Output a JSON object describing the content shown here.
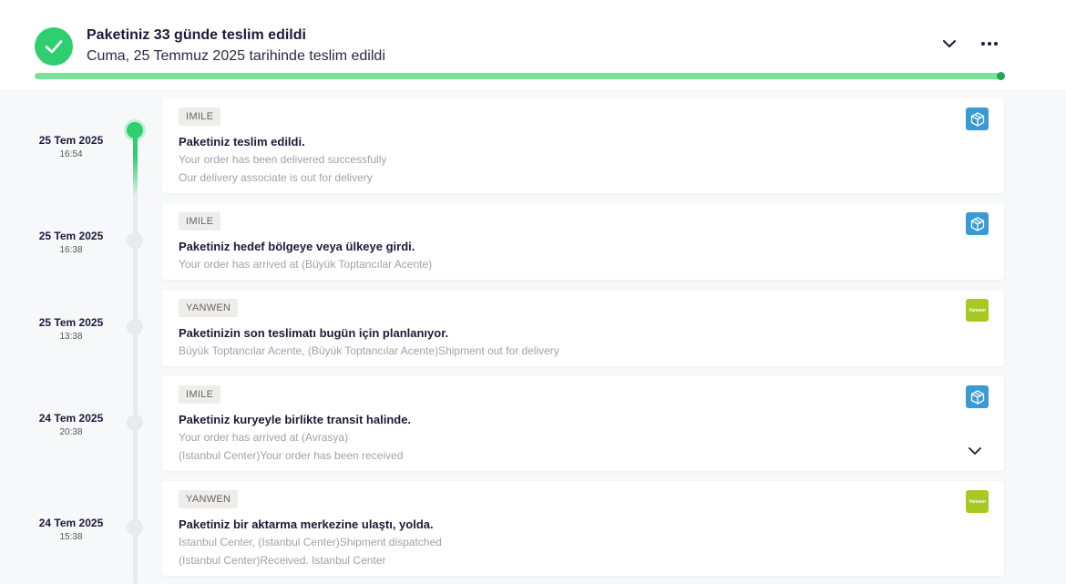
{
  "header": {
    "title": "Paketiniz 33 günde teslim edildi",
    "subtitle": "Cuma, 25 Temmuz 2025 tarihinde teslim edildi",
    "progress_percent": 100,
    "icons": {
      "status": "check-icon",
      "expand": "chevron-down-icon",
      "more": "more-dots-icon"
    },
    "colors": {
      "success": "#2fcf70",
      "progress": "#78e29b",
      "progress_end": "#1fa84e"
    }
  },
  "events": [
    {
      "date": "25 Tem 2025",
      "time": "16:54",
      "carrier": "IMILE",
      "logo": "package-box-icon",
      "title": "Paketiniz teslim edildi.",
      "lines": [
        "Your order has been delivered successfully",
        "Our delivery associate is out for delivery"
      ]
    },
    {
      "date": "25 Tem 2025",
      "time": "16:38",
      "carrier": "IMILE",
      "logo": "package-box-icon",
      "title": "Paketiniz hedef bölgeye veya ülkeye girdi.",
      "lines": [
        "Your order has arrived at (Büyük Toptancılar Acente)"
      ]
    },
    {
      "date": "25 Tem 2025",
      "time": "13:38",
      "carrier": "YANWEN",
      "logo": "yanwen-logo-icon",
      "title": "Paketinizin son teslimatı bugün için planlanıyor.",
      "lines": [
        "Büyük Toptancılar Acente, (Büyük Toptancılar Acente)Shipment out for delivery"
      ]
    },
    {
      "date": "24 Tem 2025",
      "time": "20:38",
      "carrier": "IMILE",
      "logo": "package-box-icon",
      "title": "Paketiniz kuryeyle birlikte transit halinde.",
      "lines": [
        "Your order has arrived at (Avrasya)",
        "(Istanbul Center)Your order has been received"
      ]
    },
    {
      "date": "24 Tem 2025",
      "time": "15:38",
      "carrier": "YANWEN",
      "logo": "yanwen-logo-icon",
      "title": "Paketiniz bir aktarma merkezine ulaştı, yolda.",
      "lines": [
        "Istanbul Center, (Istanbul Center)Shipment dispatched",
        "(Istanbul Center)Received. Istanbul Center"
      ]
    }
  ]
}
